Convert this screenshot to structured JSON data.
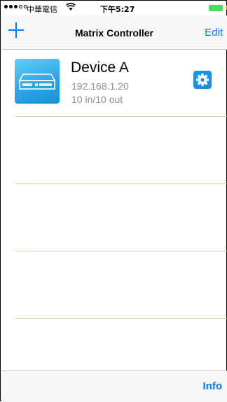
{
  "status_bar": {
    "carrier": "中華電信",
    "time": "下午5:27",
    "wifi_icon": "wifi-icon",
    "battery_color": "#4cd964"
  },
  "nav": {
    "title": "Matrix Controller",
    "edit_label": "Edit",
    "add_icon": "plus-icon",
    "accent": "#007aff"
  },
  "devices": [
    {
      "name": "Device A",
      "ip": "192.168.1.20",
      "io": "10 in/10 out",
      "icon": "matrix-device-icon",
      "settings_icon": "gear-icon"
    }
  ],
  "empty_rows": 3,
  "separator_color": "#e8c89a",
  "toolbar": {
    "info_label": "Info"
  }
}
